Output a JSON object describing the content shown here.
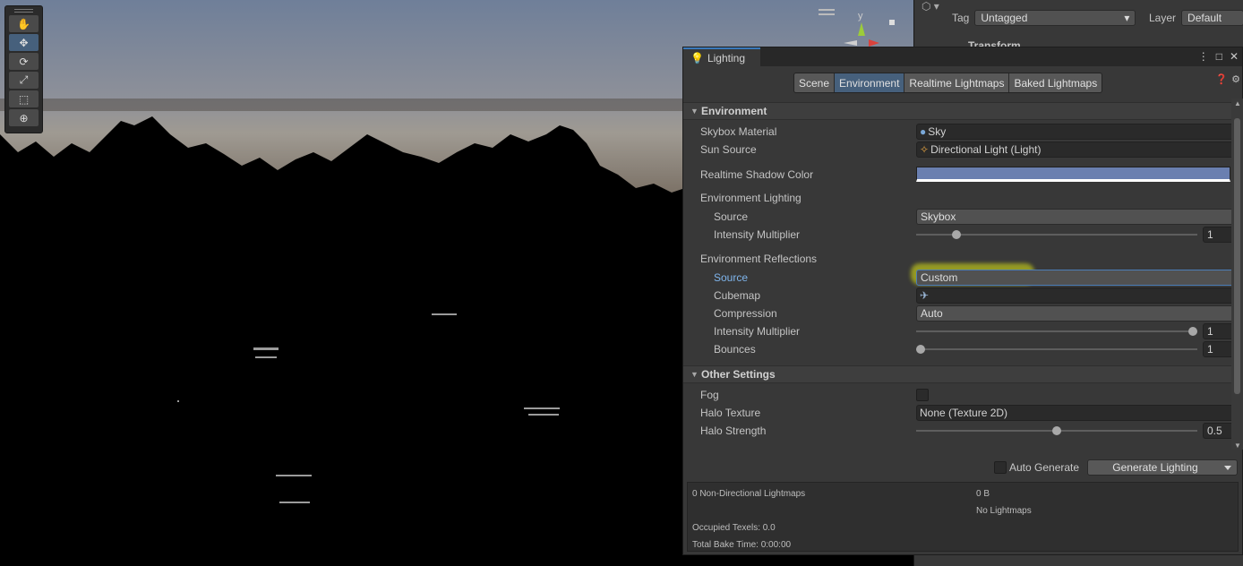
{
  "inspector": {
    "tag_label": "Tag",
    "tag_value": "Untagged",
    "layer_label": "Layer",
    "layer_value": "Default",
    "component_title": "Transform"
  },
  "scene": {
    "gizmo_axis_label": "y"
  },
  "lighting": {
    "window_title": "Lighting",
    "modes": [
      "Scene",
      "Environment",
      "Realtime Lightmaps",
      "Baked Lightmaps"
    ],
    "active_mode": "Environment",
    "environment_section": {
      "title": "Environment",
      "skybox_material_label": "Skybox Material",
      "skybox_material_value": "Sky",
      "sun_source_label": "Sun Source",
      "sun_source_value": "Directional Light (Light)",
      "realtime_shadow_color_label": "Realtime Shadow Color",
      "realtime_shadow_color": "#6a7fb0",
      "environment_lighting_label": "Environment Lighting",
      "env_lighting_source_label": "Source",
      "env_lighting_source_value": "Skybox",
      "env_lighting_intensity_label": "Intensity Multiplier",
      "env_lighting_intensity_value": "1",
      "env_lighting_intensity_fraction": 0.13,
      "environment_reflections_label": "Environment Reflections",
      "reflections_source_label": "Source",
      "reflections_source_value": "Custom",
      "cubemap_label": "Cubemap",
      "cubemap_value": "",
      "compression_label": "Compression",
      "compression_value": "Auto",
      "reflections_intensity_label": "Intensity Multiplier",
      "reflections_intensity_value": "1",
      "reflections_intensity_fraction": 1.0,
      "bounces_label": "Bounces",
      "bounces_value": "1",
      "bounces_fraction": 0.0
    },
    "other_settings_section": {
      "title": "Other Settings",
      "fog_label": "Fog",
      "fog_checked": false,
      "halo_texture_label": "Halo Texture",
      "halo_texture_value": "None (Texture 2D)",
      "halo_strength_label": "Halo Strength",
      "halo_strength_value": "0.5",
      "halo_strength_fraction": 0.5
    },
    "auto_generate_label": "Auto Generate",
    "auto_generate_checked": false,
    "generate_lighting_label": "Generate Lighting",
    "stats": {
      "lightmaps_count": "0 Non-Directional Lightmaps",
      "lightmaps_size": "0 B",
      "no_lightmaps": "No Lightmaps",
      "occupied_texels": "Occupied Texels: 0.0",
      "total_bake_time": "Total Bake Time: 0:00:00"
    }
  },
  "colors": {
    "accent_blue": "#46607c",
    "highlight_yellow": "#e1eb14",
    "panel_bg": "#383838"
  }
}
